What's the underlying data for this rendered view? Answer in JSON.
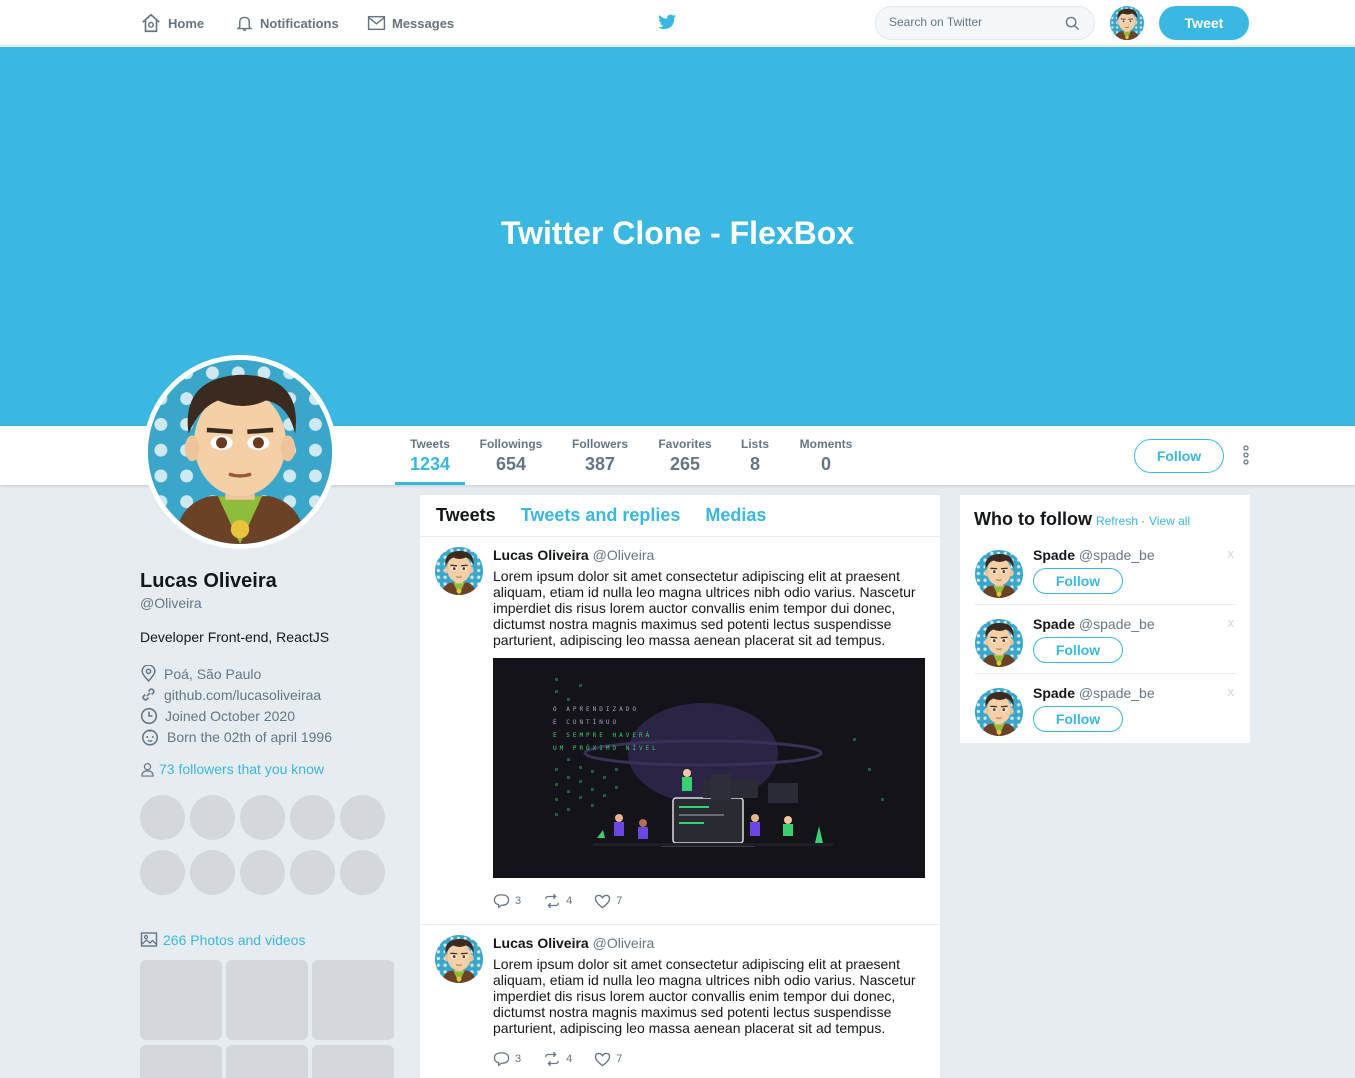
{
  "nav": {
    "home": "Home",
    "notifications": "Notifications",
    "messages": "Messages",
    "search_placeholder": "Search on Twitter",
    "tweet_button": "Tweet"
  },
  "banner": {
    "title": "Twitter Clone - FlexBox"
  },
  "stats": [
    {
      "label": "Tweets",
      "value": "1234"
    },
    {
      "label": "Followings",
      "value": "654"
    },
    {
      "label": "Followers",
      "value": "387"
    },
    {
      "label": "Favorites",
      "value": "265"
    },
    {
      "label": "Lists",
      "value": "8"
    },
    {
      "label": "Moments",
      "value": "0"
    }
  ],
  "follow_button": "Follow",
  "profile": {
    "name": "Lucas Oliveira",
    "handle": "@Oliveira",
    "bio": "Developer Front-end, ReactJS",
    "location": "Poá, São Paulo",
    "website": "github.com/lucasoliveiraa",
    "joined": "Joined October 2020",
    "born": "Born the 02th of april 1996",
    "followers_you_know": "73 followers that you know",
    "photos_videos": "266 Photos and videos"
  },
  "tabs": [
    "Tweets",
    "Tweets and replies",
    "Medias"
  ],
  "tweets": [
    {
      "name": "Lucas Oliveira",
      "handle": "@Oliveira",
      "text": "Lorem ipsum dolor sit amet consectetur adipiscing elit at praesent aliquam, etiam id nulla leo magna ultrices nibh odio varius. Nascetur imperdiet dis risus lorem auctor convallis enim tempor dui donec, dictumst nostra magnis maximus sed potenti lectus suspendisse parturient, adipiscing leo massa aenean placerat sit ad tempus.",
      "media_lines": [
        "O APRENDIZADO",
        "É CONTÍNUO",
        "E SEMPRE HAVERÁ",
        "UM PRÓXIMO NÍVEL"
      ],
      "replies": "3",
      "retweets": "4",
      "likes": "7"
    },
    {
      "name": "Lucas Oliveira",
      "handle": "@Oliveira",
      "text": "Lorem ipsum dolor sit amet consectetur adipiscing elit at praesent aliquam, etiam id nulla leo magna ultrices nibh odio varius. Nascetur imperdiet dis risus lorem auctor convallis enim tempor dui donec, dictumst nostra magnis maximus sed potenti lectus suspendisse parturient, adipiscing leo massa aenean placerat sit ad tempus.",
      "replies": "3",
      "retweets": "4",
      "likes": "7"
    }
  ],
  "who_to_follow": {
    "title": "Who to follow",
    "refresh": "Refresh",
    "view_all": "View all",
    "suggestions": [
      {
        "name": "Spade",
        "handle": "@spade_be",
        "button": "Follow",
        "close": "x"
      },
      {
        "name": "Spade",
        "handle": "@spade_be",
        "button": "Follow",
        "close": "x"
      },
      {
        "name": "Spade",
        "handle": "@spade_be",
        "button": "Follow",
        "close": "x"
      }
    ]
  },
  "colors": {
    "accent": "#3bb8e2",
    "text": "#14171a",
    "muted": "#657786",
    "background": "#e6ecf0"
  }
}
